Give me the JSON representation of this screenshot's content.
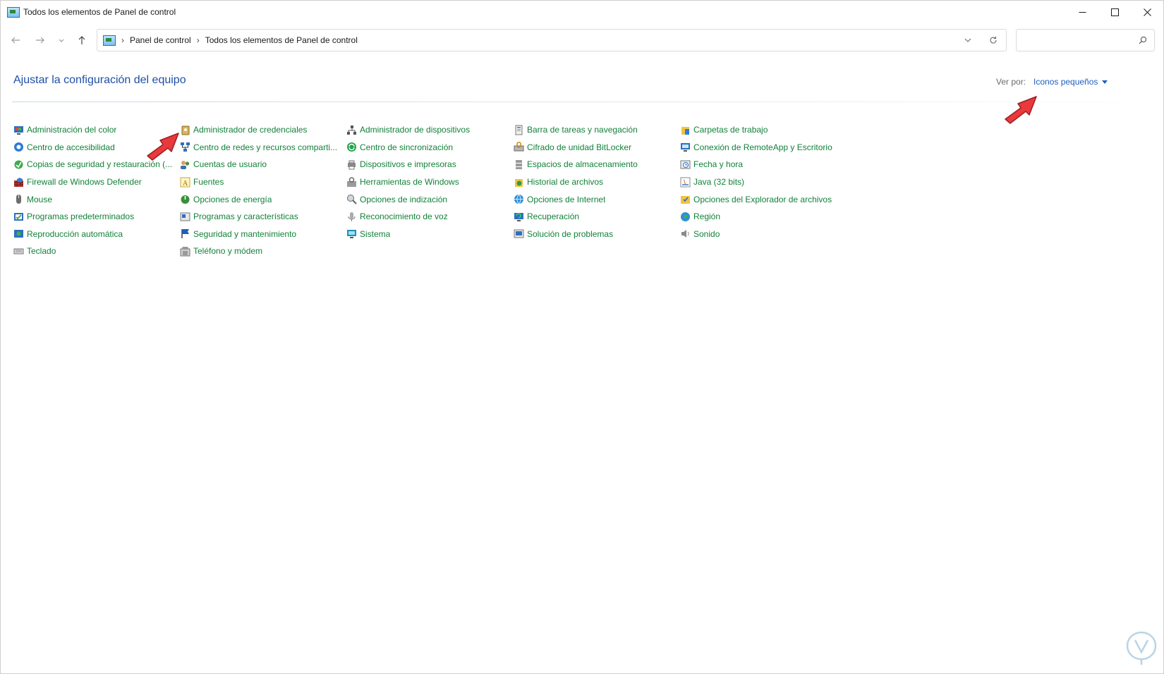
{
  "window": {
    "title": "Todos los elementos de Panel de control",
    "controls": [
      "minimize",
      "maximize",
      "close"
    ]
  },
  "address_bar": {
    "breadcrumbs": [
      "Panel de control",
      "Todos los elementos de Panel de control"
    ],
    "search_placeholder": ""
  },
  "header": {
    "title": "Ajustar la configuración del equipo",
    "view_by_label": "Ver por:",
    "view_by_value": "Iconos pequeños"
  },
  "items": [
    {
      "label": "Administración del color",
      "icon": "color-management-icon"
    },
    {
      "label": "Administrador de credenciales",
      "icon": "credential-manager-icon"
    },
    {
      "label": "Administrador de dispositivos",
      "icon": "device-manager-icon"
    },
    {
      "label": "Barra de tareas y navegación",
      "icon": "taskbar-icon"
    },
    {
      "label": "Carpetas de trabajo",
      "icon": "work-folders-icon"
    },
    {
      "label": "Centro de accesibilidad",
      "icon": "accessibility-icon"
    },
    {
      "label": "Centro de redes y recursos comparti...",
      "icon": "network-center-icon"
    },
    {
      "label": "Centro de sincronización",
      "icon": "sync-center-icon"
    },
    {
      "label": "Cifrado de unidad BitLocker",
      "icon": "bitlocker-icon"
    },
    {
      "label": "Conexión de RemoteApp y Escritorio",
      "icon": "remoteapp-icon"
    },
    {
      "label": "Copias de seguridad y restauración (...",
      "icon": "backup-restore-icon"
    },
    {
      "label": "Cuentas de usuario",
      "icon": "user-accounts-icon"
    },
    {
      "label": "Dispositivos e impresoras",
      "icon": "devices-printers-icon"
    },
    {
      "label": "Espacios de almacenamiento",
      "icon": "storage-spaces-icon"
    },
    {
      "label": "Fecha y hora",
      "icon": "date-time-icon"
    },
    {
      "label": "Firewall de Windows Defender",
      "icon": "firewall-icon"
    },
    {
      "label": "Fuentes",
      "icon": "fonts-icon"
    },
    {
      "label": "Herramientas de Windows",
      "icon": "windows-tools-icon"
    },
    {
      "label": "Historial de archivos",
      "icon": "file-history-icon"
    },
    {
      "label": "Java (32 bits)",
      "icon": "java-icon"
    },
    {
      "label": "Mouse",
      "icon": "mouse-icon"
    },
    {
      "label": "Opciones de energía",
      "icon": "power-options-icon"
    },
    {
      "label": "Opciones de indización",
      "icon": "indexing-options-icon"
    },
    {
      "label": "Opciones de Internet",
      "icon": "internet-options-icon"
    },
    {
      "label": "Opciones del Explorador de archivos",
      "icon": "explorer-options-icon"
    },
    {
      "label": "Programas predeterminados",
      "icon": "default-programs-icon"
    },
    {
      "label": "Programas y características",
      "icon": "programs-features-icon"
    },
    {
      "label": "Reconocimiento de voz",
      "icon": "speech-recognition-icon"
    },
    {
      "label": "Recuperación",
      "icon": "recovery-icon"
    },
    {
      "label": "Región",
      "icon": "region-icon"
    },
    {
      "label": "Reproducción automática",
      "icon": "autoplay-icon"
    },
    {
      "label": "Seguridad y mantenimiento",
      "icon": "security-maintenance-icon"
    },
    {
      "label": "Sistema",
      "icon": "system-icon"
    },
    {
      "label": "Solución de problemas",
      "icon": "troubleshooting-icon"
    },
    {
      "label": "Sonido",
      "icon": "sound-icon"
    },
    {
      "label": "Teclado",
      "icon": "keyboard-icon"
    },
    {
      "label": "Teléfono y módem",
      "icon": "phone-modem-icon"
    }
  ],
  "colors": {
    "link_green": "#12813a",
    "heading_blue": "#1e4fa7",
    "annotation_red": "#e8393c"
  }
}
